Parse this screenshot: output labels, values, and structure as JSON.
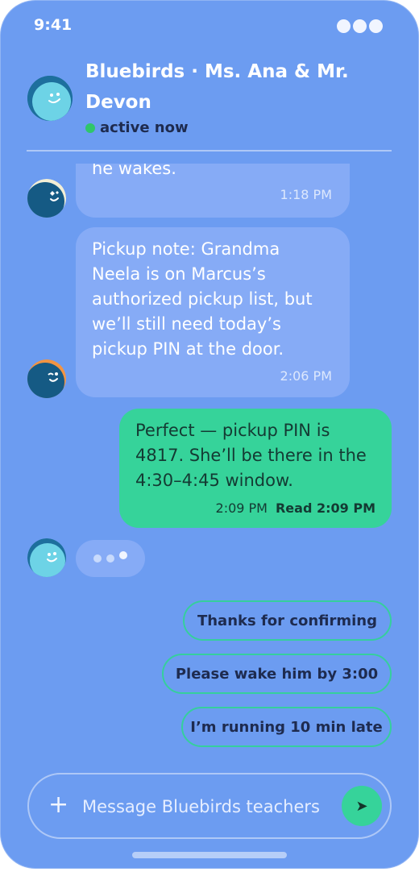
{
  "status_bar": {
    "time": "9:41"
  },
  "header": {
    "title": "Bluebirds · Ms. Ana & Mr. Devon",
    "presence": "active now"
  },
  "messages": [
    {
      "text": "he wakes.",
      "time": "1:18 PM",
      "direction": "in"
    },
    {
      "text": "Pickup note: Grandma Neela is on Marcus’s authorized pickup list, but we’ll still need today’s pickup PIN at the door.",
      "time": "2:06 PM",
      "direction": "in"
    },
    {
      "text": "Perfect — pickup PIN is 4817. She’ll be there in the 4:30–4:45 window.",
      "time": "2:09 PM",
      "receipt": "Read 2:09 PM",
      "direction": "out"
    }
  ],
  "quick_replies": [
    "Thanks for confirming",
    "Please wake him by 3:00",
    "I’m running 10 min late"
  ],
  "composer": {
    "placeholder": "Message Bluebirds teachers"
  },
  "colors": {
    "background": "#6c9cf1",
    "incoming_bubble": "#86abf6",
    "outgoing_bubble": "#36d39a",
    "presence": "#2fc66a"
  },
  "icons": [
    "signal-dots-icon",
    "plus-icon",
    "send-icon"
  ]
}
